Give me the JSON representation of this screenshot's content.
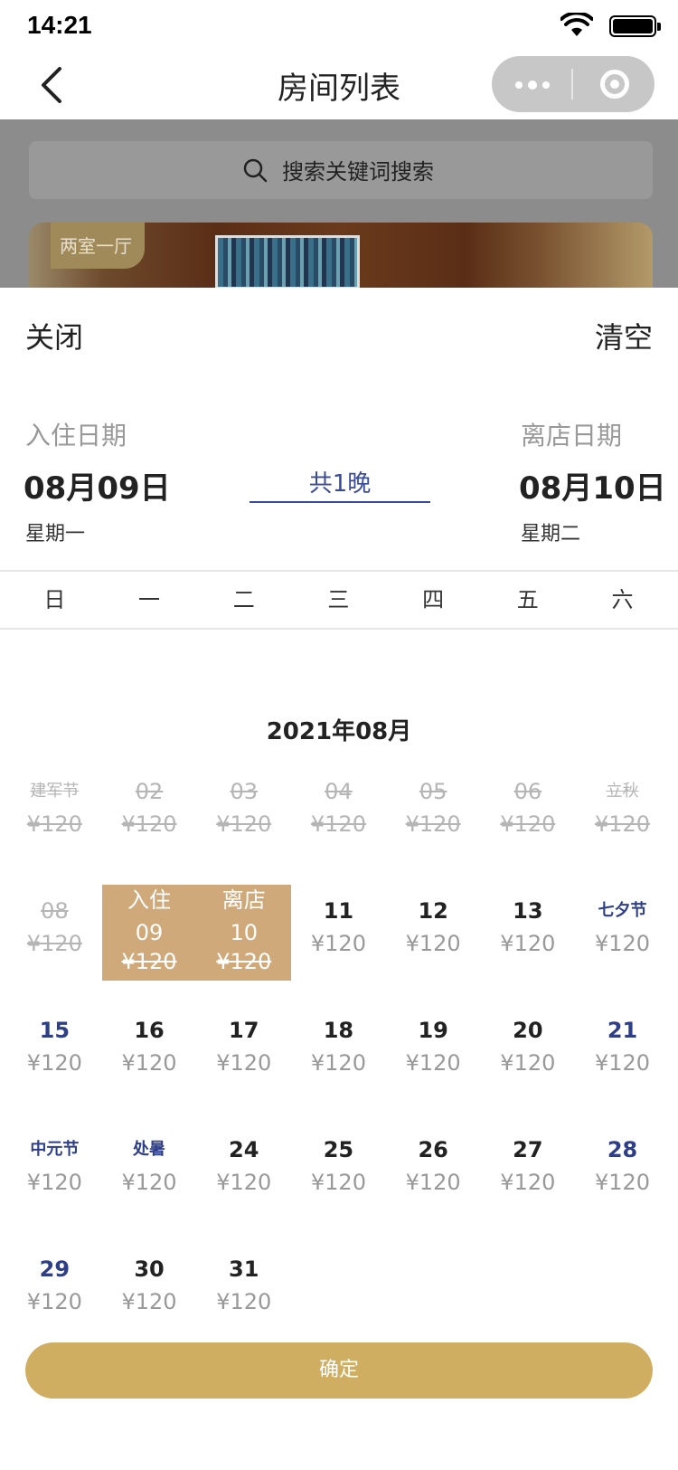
{
  "status_bar": {
    "time": "14:21"
  },
  "nav": {
    "title": "房间列表"
  },
  "search": {
    "placeholder": "搜索关键词搜索"
  },
  "room_card": {
    "tag": "两室一厅"
  },
  "sheet": {
    "close_label": "关闭",
    "clear_label": "清空",
    "checkin": {
      "label": "入住日期",
      "date": "08月09日",
      "weekday": "星期一"
    },
    "checkout": {
      "label": "离店日期",
      "date": "08月10日",
      "weekday": "星期二"
    },
    "nights": "共1晚",
    "weekdays": [
      "日",
      "一",
      "二",
      "三",
      "四",
      "五",
      "六"
    ],
    "month_title": "2021年08月",
    "days": [
      {
        "label": "建军节",
        "price": "¥120",
        "state": "past",
        "holiday": true
      },
      {
        "label": "02",
        "price": "¥120",
        "state": "past"
      },
      {
        "label": "03",
        "price": "¥120",
        "state": "past"
      },
      {
        "label": "04",
        "price": "¥120",
        "state": "past"
      },
      {
        "label": "05",
        "price": "¥120",
        "state": "past"
      },
      {
        "label": "06",
        "price": "¥120",
        "state": "past"
      },
      {
        "label": "立秋",
        "price": "¥120",
        "state": "past",
        "holiday": true
      },
      {
        "label": "08",
        "price": "¥120",
        "state": "past"
      },
      {
        "label": "09",
        "price": "¥120",
        "state": "selected",
        "tag": "入住"
      },
      {
        "label": "10",
        "price": "¥120",
        "state": "selected",
        "tag": "离店"
      },
      {
        "label": "11",
        "price": "¥120",
        "state": "normal"
      },
      {
        "label": "12",
        "price": "¥120",
        "state": "normal"
      },
      {
        "label": "13",
        "price": "¥120",
        "state": "normal"
      },
      {
        "label": "七夕节",
        "price": "¥120",
        "state": "normal",
        "holiday": true,
        "blue": true
      },
      {
        "label": "15",
        "price": "¥120",
        "state": "normal",
        "blue": true
      },
      {
        "label": "16",
        "price": "¥120",
        "state": "normal"
      },
      {
        "label": "17",
        "price": "¥120",
        "state": "normal"
      },
      {
        "label": "18",
        "price": "¥120",
        "state": "normal"
      },
      {
        "label": "19",
        "price": "¥120",
        "state": "normal"
      },
      {
        "label": "20",
        "price": "¥120",
        "state": "normal"
      },
      {
        "label": "21",
        "price": "¥120",
        "state": "normal",
        "blue": true
      },
      {
        "label": "中元节",
        "price": "¥120",
        "state": "normal",
        "holiday": true,
        "blue": true
      },
      {
        "label": "处暑",
        "price": "¥120",
        "state": "normal",
        "holiday": true,
        "blue": true
      },
      {
        "label": "24",
        "price": "¥120",
        "state": "normal"
      },
      {
        "label": "25",
        "price": "¥120",
        "state": "normal"
      },
      {
        "label": "26",
        "price": "¥120",
        "state": "normal"
      },
      {
        "label": "27",
        "price": "¥120",
        "state": "normal"
      },
      {
        "label": "28",
        "price": "¥120",
        "state": "normal",
        "blue": true
      },
      {
        "label": "29",
        "price": "¥120",
        "state": "normal",
        "blue": true
      },
      {
        "label": "30",
        "price": "¥120",
        "state": "normal"
      },
      {
        "label": "31",
        "price": "¥120",
        "state": "normal"
      }
    ],
    "confirm_label": "确定"
  },
  "colors": {
    "accent_blue": "#2e3f88",
    "selected_bg": "#cfa97a",
    "confirm_bg": "#cfae62"
  }
}
